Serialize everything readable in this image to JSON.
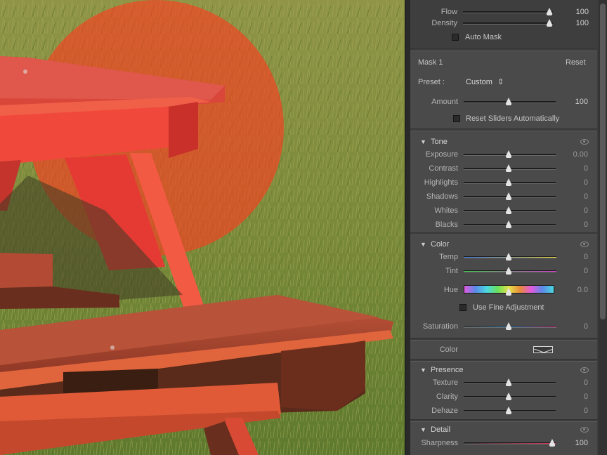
{
  "brush": {
    "flow_label": "Flow",
    "flow_value": "100",
    "flow_level": 1.0,
    "density_label": "Density",
    "density_value": "100",
    "density_level": 1.0,
    "automask_label": "Auto Mask"
  },
  "mask": {
    "name": "Mask 1",
    "reset_label": "Reset",
    "preset_label": "Preset :",
    "preset_value": "Custom",
    "preset_arrow": "⇕",
    "amount_label": "Amount",
    "amount_value": "100",
    "amount_level": 0.5,
    "reset_sliders_label": "Reset Sliders Automatically"
  },
  "tone": {
    "title": "Tone",
    "sliders": [
      {
        "label": "Exposure",
        "value": "0.00",
        "level": 0.5
      },
      {
        "label": "Contrast",
        "value": "0",
        "level": 0.5
      },
      {
        "label": "Highlights",
        "value": "0",
        "level": 0.5
      },
      {
        "label": "Shadows",
        "value": "0",
        "level": 0.5
      },
      {
        "label": "Whites",
        "value": "0",
        "level": 0.5
      },
      {
        "label": "Blacks",
        "value": "0",
        "level": 0.5
      }
    ]
  },
  "color": {
    "title": "Color",
    "temp_label": "Temp",
    "temp_value": "0",
    "temp_level": 0.5,
    "tint_label": "Tint",
    "tint_value": "0",
    "tint_level": 0.5,
    "hue_label": "Hue",
    "hue_value": "0.0",
    "hue_level": 0.5,
    "fine_label": "Use Fine Adjustment",
    "saturation_label": "Saturation",
    "saturation_value": "0",
    "saturation_level": 0.5,
    "swatch_label": "Color"
  },
  "presence": {
    "title": "Presence",
    "sliders": [
      {
        "label": "Texture",
        "value": "0",
        "level": 0.5
      },
      {
        "label": "Clarity",
        "value": "0",
        "level": 0.5
      },
      {
        "label": "Dehaze",
        "value": "0",
        "level": 0.5
      }
    ]
  },
  "detail": {
    "title": "Detail",
    "sharpness_label": "Sharpness",
    "sharpness_value": "100",
    "sharpness_level": 1.0
  },
  "colors": {
    "panel_bg": "#4a4a4a",
    "mask_overlay": "#ff3a1f",
    "table_red": "#e8453a",
    "grass": "#7d8a3c"
  }
}
